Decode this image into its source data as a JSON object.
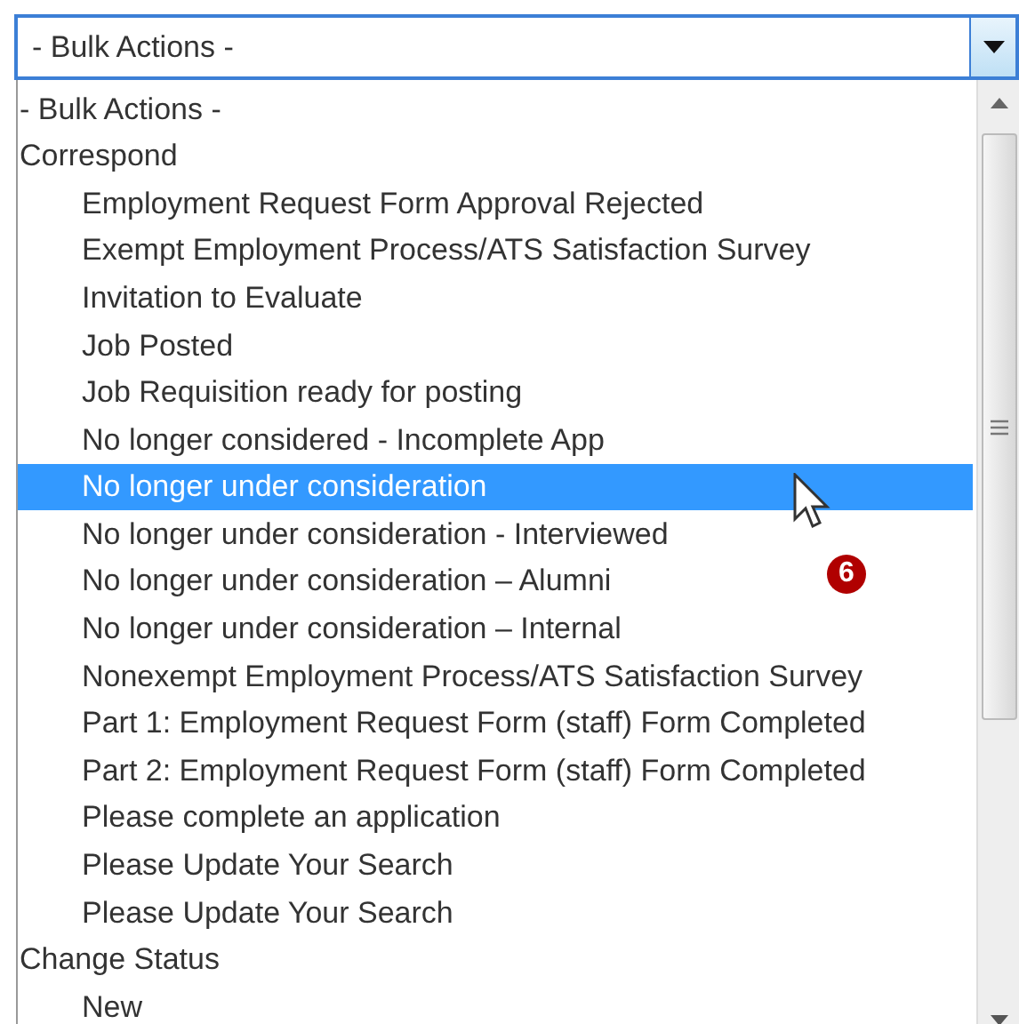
{
  "select": {
    "value": "- Bulk Actions -"
  },
  "options": [
    {
      "label": "- Bulk Actions -",
      "selected": false
    },
    {
      "label": "Correspond",
      "selected": false,
      "children": [
        {
          "label": "Employment Request Form Approval Rejected",
          "selected": false
        },
        {
          "label": "Exempt Employment Process/ATS Satisfaction Survey",
          "selected": false
        },
        {
          "label": "Invitation to Evaluate",
          "selected": false
        },
        {
          "label": "Job Posted",
          "selected": false
        },
        {
          "label": "Job Requisition ready for posting",
          "selected": false
        },
        {
          "label": "No longer considered - Incomplete App",
          "selected": false
        },
        {
          "label": "No longer under consideration",
          "selected": true
        },
        {
          "label": "No longer under consideration - Interviewed",
          "selected": false
        },
        {
          "label": "No longer under consideration – Alumni",
          "selected": false
        },
        {
          "label": "No longer under consideration – Internal",
          "selected": false
        },
        {
          "label": "Nonexempt Employment Process/ATS Satisfaction Survey",
          "selected": false
        },
        {
          "label": "Part 1: Employment Request Form (staff) Form Completed",
          "selected": false
        },
        {
          "label": "Part 2: Employment Request Form (staff) Form Completed",
          "selected": false
        },
        {
          "label": "Please complete an application",
          "selected": false
        },
        {
          "label": "Please Update Your Search",
          "selected": false
        },
        {
          "label": "Please Update Your Search",
          "selected": false
        }
      ]
    },
    {
      "label": "Change Status",
      "selected": false,
      "children": [
        {
          "label": "New",
          "selected": false
        }
      ]
    }
  ],
  "callout": "6"
}
